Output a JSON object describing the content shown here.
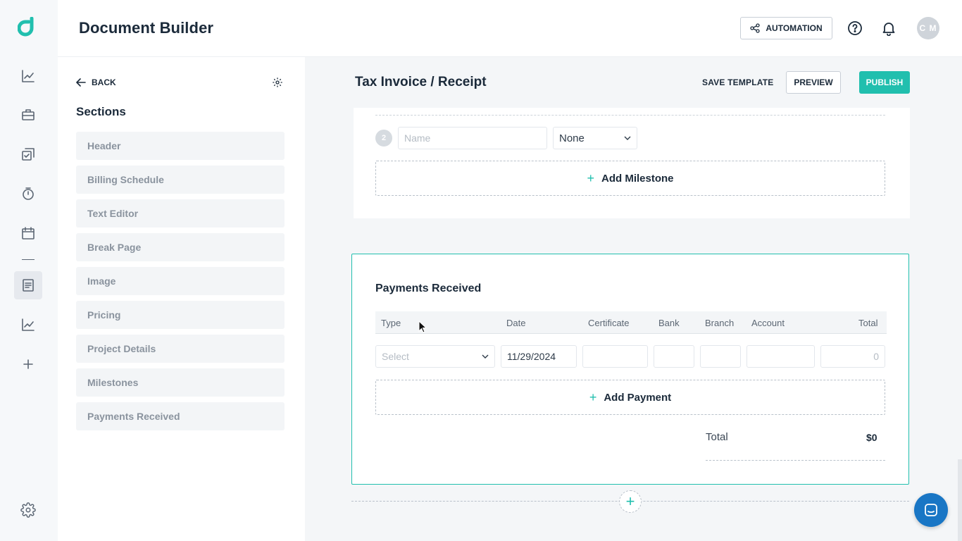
{
  "app": {
    "title": "Document Builder"
  },
  "header": {
    "automation_label": "AUTOMATION",
    "avatar_initials": "C M"
  },
  "sections_panel": {
    "back_label": "BACK",
    "title": "Sections",
    "items": [
      {
        "label": "Header"
      },
      {
        "label": "Billing Schedule"
      },
      {
        "label": "Text Editor"
      },
      {
        "label": "Break Page"
      },
      {
        "label": "Image"
      },
      {
        "label": "Pricing"
      },
      {
        "label": "Project Details"
      },
      {
        "label": "Milestones"
      },
      {
        "label": "Payments Received"
      }
    ]
  },
  "document": {
    "title": "Tax Invoice / Receipt",
    "save_template_label": "SAVE TEMPLATE",
    "preview_label": "PREVIEW",
    "publish_label": "PUBLISH"
  },
  "milestones": {
    "row_number": "2",
    "name_placeholder": "Name",
    "select_value": "None",
    "add_label": "Add Milestone"
  },
  "payments": {
    "title": "Payments Received",
    "columns": [
      "Type",
      "Date",
      "Certificate",
      "Bank",
      "Branch",
      "Account",
      "Total"
    ],
    "row": {
      "type_placeholder": "Select",
      "date": "11/29/2024",
      "total": "0"
    },
    "add_label": "Add Payment",
    "total_label": "Total",
    "total_value": "$0"
  },
  "colors": {
    "accent": "#21bfae",
    "chat": "#1976c5",
    "text_dark": "#1b2a3a"
  },
  "icons": {
    "rail": [
      "analytics-icon",
      "briefcase-icon",
      "tasks-icon",
      "timer-icon",
      "calendar-icon",
      "document-icon",
      "chart-icon",
      "plus-icon",
      "settings-icon"
    ],
    "header": [
      "automation-icon",
      "help-icon",
      "bell-icon"
    ]
  }
}
